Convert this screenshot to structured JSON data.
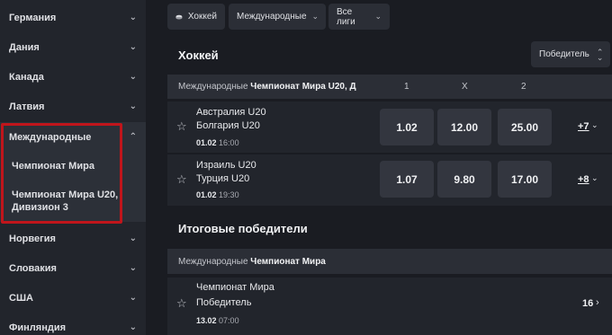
{
  "sidebar": {
    "items": [
      {
        "label": "Германия"
      },
      {
        "label": "Дания"
      },
      {
        "label": "Канада"
      },
      {
        "label": "Латвия"
      },
      {
        "label": "Международные"
      },
      {
        "label": "Норвегия"
      },
      {
        "label": "Словакия"
      },
      {
        "label": "США"
      },
      {
        "label": "Финляндия"
      }
    ],
    "sub_items": [
      {
        "label": "Чемпионат Мира"
      },
      {
        "label_line1": "Чемпионат Мира U20,",
        "label_line2": "Дивизион 3"
      }
    ],
    "highlight_color": "#c0151b"
  },
  "filters": {
    "sport": "Хоккей",
    "region": "Международные",
    "leagues": "Все лиги"
  },
  "main": {
    "title": "Хоккей",
    "sort_label": "Победитель",
    "league_header": {
      "prefix": "Международные",
      "name": "Чемпионат Мира U20, Д"
    },
    "cols": [
      "1",
      "X",
      "2"
    ],
    "matches": [
      {
        "team1": "Австралия U20",
        "team2": "Болгария U20",
        "date": "01.02",
        "time": "16:00",
        "odd1": "1.02",
        "oddX": "12.00",
        "odd2": "25.00",
        "more": "+7"
      },
      {
        "team1": "Израиль U20",
        "team2": "Турция U20",
        "date": "01.02",
        "time": "19:30",
        "odd1": "1.07",
        "oddX": "9.80",
        "odd2": "17.00",
        "more": "+8"
      }
    ],
    "outright_title": "Итоговые победители",
    "outright_header": {
      "prefix": "Международные",
      "name": "Чемпионат Мира"
    },
    "outright": {
      "line1": "Чемпионат Мира",
      "line2": "Победитель",
      "date": "13.02",
      "time": "07:00",
      "count": "16"
    }
  }
}
